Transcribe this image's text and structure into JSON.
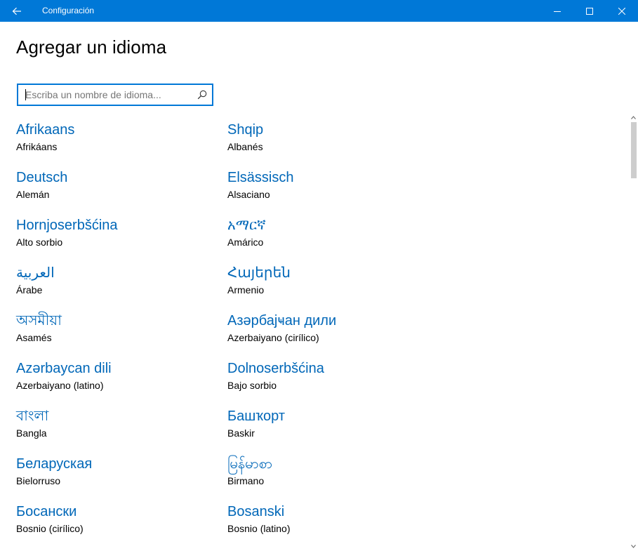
{
  "window": {
    "title": "Configuración",
    "back_icon": "back-arrow-icon",
    "controls": [
      "minimize-icon",
      "maximize-icon",
      "close-icon"
    ],
    "accent_color": "#0078d7"
  },
  "page": {
    "title": "Agregar un idioma"
  },
  "search": {
    "placeholder": "Escriba un nombre de idioma...",
    "value": "",
    "icon": "search-icon"
  },
  "languages": [
    {
      "native": "Afrikaans",
      "localized": "Afrikáans"
    },
    {
      "native": "Shqip",
      "localized": "Albanés"
    },
    {
      "native": "Deutsch",
      "localized": "Alemán"
    },
    {
      "native": "Elsässisch",
      "localized": "Alsaciano"
    },
    {
      "native": "Hornjoserbšćina",
      "localized": "Alto sorbio"
    },
    {
      "native": "አማርኛ",
      "localized": "Amárico"
    },
    {
      "native": "العربية",
      "localized": "Árabe"
    },
    {
      "native": "Հայերեն",
      "localized": "Armenio"
    },
    {
      "native": "অসমীয়া",
      "localized": "Asamés"
    },
    {
      "native": "Азәрбајҹан дили",
      "localized": "Azerbaiyano (cirílico)"
    },
    {
      "native": "Azərbaycan dili",
      "localized": "Azerbaiyano (latino)"
    },
    {
      "native": "Dolnoserbšćina",
      "localized": "Bajo sorbio"
    },
    {
      "native": "বাংলা",
      "localized": "Bangla"
    },
    {
      "native": "Башҡорт",
      "localized": "Baskir"
    },
    {
      "native": "Беларуская",
      "localized": "Bielorruso"
    },
    {
      "native": "မြန်မာစာ",
      "localized": "Birmano"
    },
    {
      "native": "Босански",
      "localized": "Bosnio (cirílico)"
    },
    {
      "native": "Bosanski",
      "localized": "Bosnio (latino)"
    }
  ]
}
